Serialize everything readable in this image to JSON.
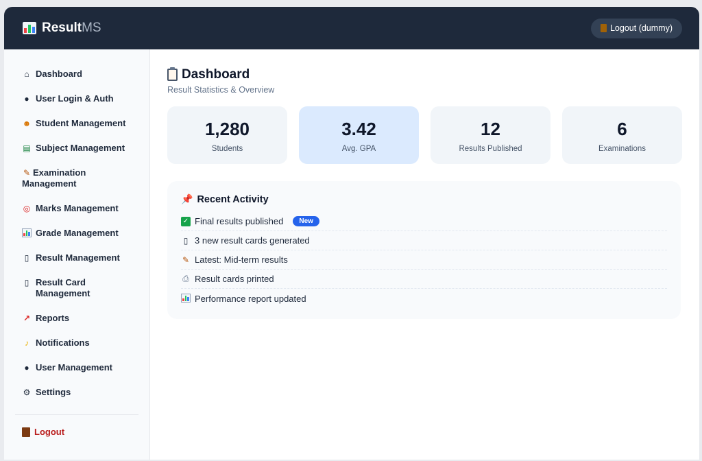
{
  "header": {
    "brand_bold": "Result",
    "brand_light": "MS",
    "logout_label": "Logout (dummy)"
  },
  "sidebar": {
    "items": [
      {
        "label": "Dashboard",
        "icon": "house-icon"
      },
      {
        "label": "User Login & Auth",
        "icon": "user-icon"
      },
      {
        "label": "Student Management",
        "icon": "student-icon"
      },
      {
        "label": "Subject Management",
        "icon": "books-icon"
      },
      {
        "label": "Examination Management",
        "icon": "memo-icon"
      },
      {
        "label": "Marks Management",
        "icon": "target-icon"
      },
      {
        "label": "Grade Management",
        "icon": "bar-chart-icon"
      },
      {
        "label": "Result Management",
        "icon": "document-icon"
      },
      {
        "label": "Result Card Management",
        "icon": "card-icon"
      },
      {
        "label": "Reports",
        "icon": "trend-chart-icon"
      },
      {
        "label": "Notifications",
        "icon": "bell-icon"
      },
      {
        "label": "User Management",
        "icon": "users-icon"
      },
      {
        "label": "Settings",
        "icon": "gear-icon"
      }
    ],
    "logout_label": "Logout"
  },
  "page": {
    "title": "Dashboard",
    "subtitle": "Result Statistics & Overview"
  },
  "stats": [
    {
      "value": "1,280",
      "label": "Students"
    },
    {
      "value": "3.42",
      "label": "Avg. GPA"
    },
    {
      "value": "12",
      "label": "Results Published"
    },
    {
      "value": "6",
      "label": "Examinations"
    }
  ],
  "activity": {
    "title": "Recent Activity",
    "items": [
      {
        "text": "Final results published",
        "icon": "check-icon",
        "badge": "New"
      },
      {
        "text": "3 new result cards generated",
        "icon": "card-icon"
      },
      {
        "text": "Latest: Mid-term results",
        "icon": "memo-icon"
      },
      {
        "text": "Result cards printed",
        "icon": "printer-icon"
      },
      {
        "text": "Performance report updated",
        "icon": "bar-chart-icon"
      }
    ]
  },
  "colors": {
    "topbar": "#1e293b",
    "accent": "#2563eb",
    "logout": "#b91c1c",
    "active_card": "#dbeafe"
  }
}
